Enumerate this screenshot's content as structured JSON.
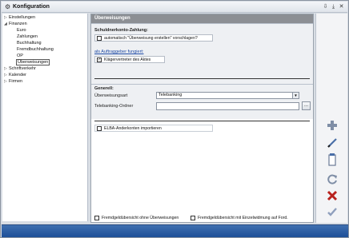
{
  "window": {
    "title": "Konfiguration",
    "pin_glyph": "⇩",
    "pin_glyph2": "⤓",
    "close_glyph": "✕"
  },
  "tree": {
    "items": [
      {
        "label": "Einstellungen",
        "expander": "▷"
      },
      {
        "label": "Finanzen",
        "expander": "◢"
      },
      {
        "label": "Euro",
        "expander": ""
      },
      {
        "label": "Zahlungen",
        "expander": ""
      },
      {
        "label": "Buchhaltung",
        "expander": ""
      },
      {
        "label": "Fremdbuchhaltung",
        "expander": ""
      },
      {
        "label": "OP",
        "expander": ""
      },
      {
        "label": "Überweisungen",
        "expander": ""
      },
      {
        "label": "Schriftverkehr",
        "expander": "▷"
      },
      {
        "label": "Kalender",
        "expander": "▷"
      },
      {
        "label": "Firmen",
        "expander": "▷"
      }
    ]
  },
  "content": {
    "header": "Überweisungen",
    "schuldner_heading": "Schuldnerkonto-Zahlung:",
    "chk_vorschlag": "automatisch \"Überweisung erstellen\" vorschlagen?",
    "chk_vorschlag_checked": "",
    "auftraggeber_link": "als Auftraggeber fungiert:",
    "chk_klaeger": "Klägervertreter des Aktes",
    "chk_klaeger_checked": "✓",
    "generell_heading": "Generell:",
    "ueberweisungsart_label": "Überweisungsart",
    "ueberweisungsart_value": "Telebanking",
    "telebanking_label": "Telebanking-Ordner",
    "telebanking_value": "",
    "browse_label": "...",
    "chk_elba": "ELBA-Anderkonten importieren",
    "chk_elba_checked": "",
    "bottom_chk1": "Fremdgeldübersicht ohne Überweisungen",
    "bottom_chk2": "Fremdgeldübersicht mit Einzelwidmung auf Ford.",
    "dropdown_arrow": "▼"
  },
  "toolbar": {
    "icons": [
      "add-icon",
      "edit-icon",
      "document-icon",
      "refresh-icon",
      "delete-icon",
      "confirm-icon"
    ]
  },
  "colors": {
    "header_bg": "#8c8f94",
    "footer_bg": "#1d4f98",
    "add": "#4a6fa8",
    "delete": "#b8221e",
    "confirm": "#7d8fb0"
  }
}
